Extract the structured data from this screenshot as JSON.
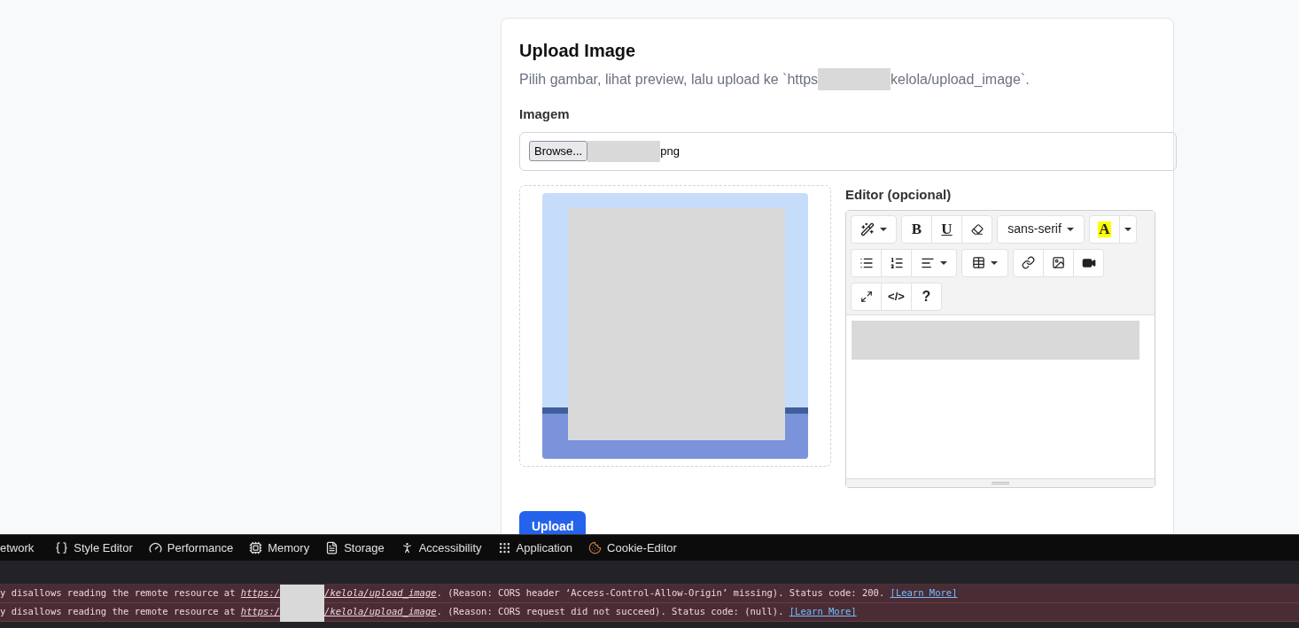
{
  "card": {
    "title": "Upload Image",
    "desc_before": "Pilih gambar, lihat preview, lalu upload ke `https",
    "desc_after": "kelola/upload_image`.",
    "file_label": "Imagem",
    "browse": "Browse...",
    "file_suffix": "png",
    "editor_label": "Editor (opcional)",
    "toolbar": {
      "bold": "B",
      "underline": "U",
      "font": "sans-serif",
      "highlight": "A",
      "code": "</>",
      "help": "?"
    },
    "upload": "Upload"
  },
  "devtools": {
    "tabs": [
      "etwork",
      "Style Editor",
      "Performance",
      "Memory",
      "Storage",
      "Accessibility",
      "Application",
      "Cookie-Editor"
    ],
    "messages": [
      {
        "before": "y disallows reading the remote resource at ",
        "link_start": "https:/",
        "link_end": "/kelola/upload_image",
        "after": ". (Reason: CORS header ‘Access-Control-Allow-Origin’ missing). Status code: 200. ",
        "more": "[Learn More]"
      },
      {
        "before": "y disallows reading the remote resource at ",
        "link_start": "https:/",
        "link_end": "/kelola/upload_image",
        "after": ". (Reason: CORS request did not succeed). Status code: (null). ",
        "more": "[Learn More]"
      }
    ]
  }
}
